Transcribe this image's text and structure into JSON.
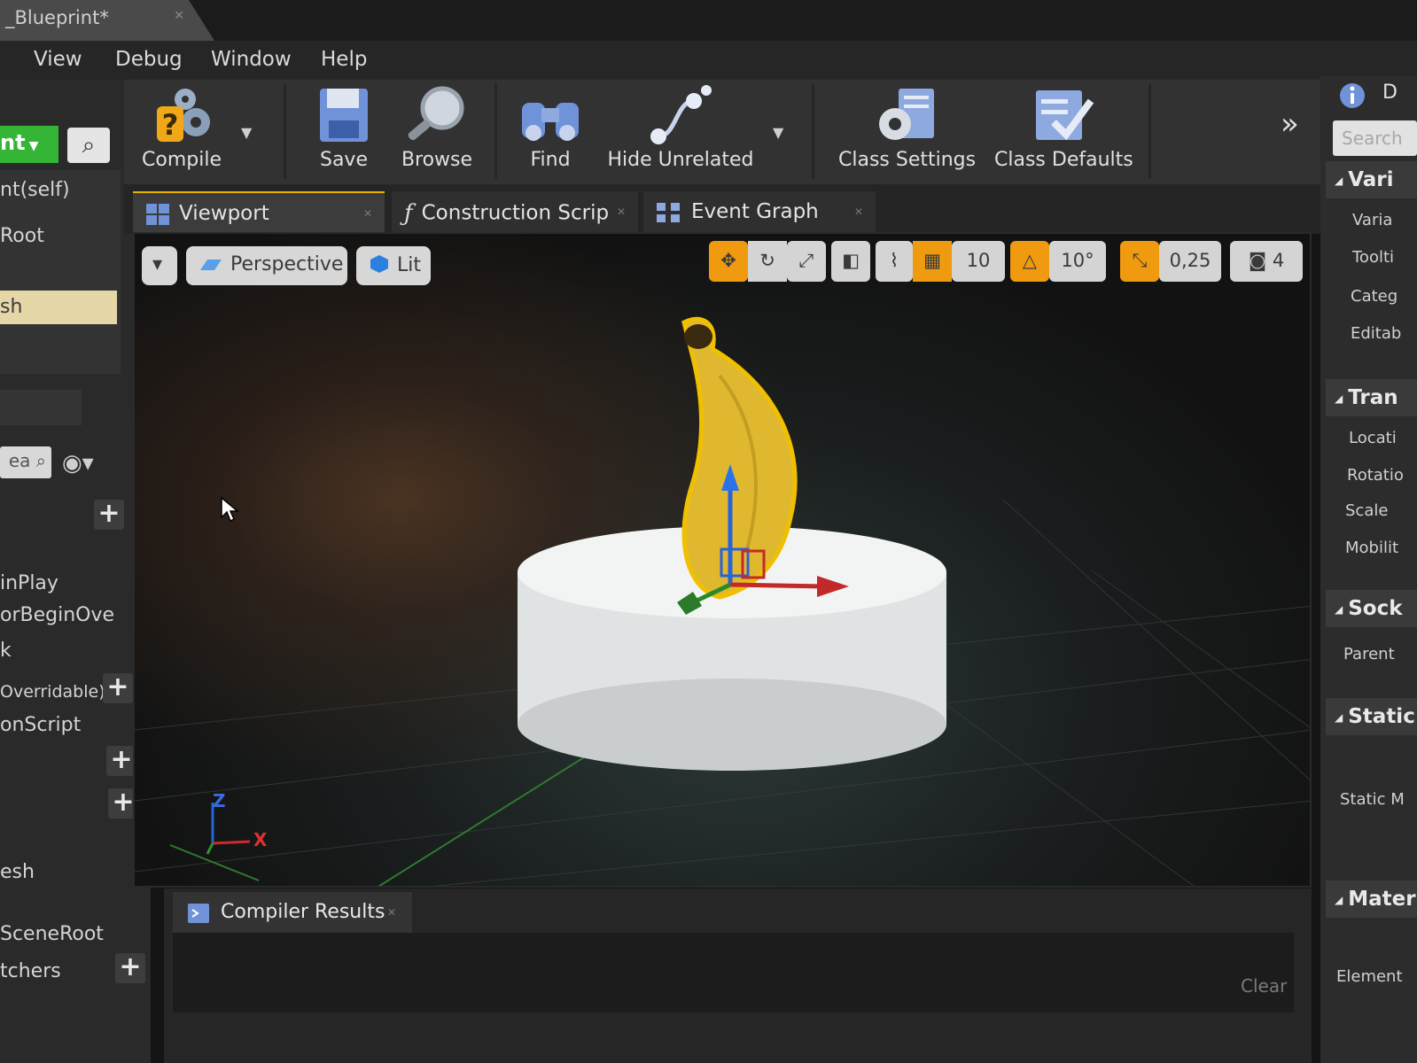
{
  "window": {
    "tab_title": "_Blueprint*"
  },
  "menu": {
    "items": [
      "View",
      "Debug",
      "Window",
      "Help"
    ]
  },
  "left_panel": {
    "add_button": "nt",
    "rows_top": [
      "nt(self)",
      "Root",
      "sh"
    ],
    "search_placeholder": "ea",
    "rows_bottom": [
      "inPlay",
      "orBeginOve",
      "k",
      "Overridable)",
      "onScript",
      "esh",
      "SceneRoot",
      "tchers"
    ]
  },
  "toolbar": {
    "compile": "Compile",
    "save": "Save",
    "browse": "Browse",
    "find": "Find",
    "hide_unrelated": "Hide Unrelated",
    "class_settings": "Class Settings",
    "class_defaults": "Class Defaults"
  },
  "editor_tabs": [
    "Viewport",
    "Construction Scrip",
    "Event Graph"
  ],
  "viewport": {
    "view_mode": "Perspective",
    "lighting": "Lit",
    "grid_snap": "10",
    "rotation_snap": "10°",
    "scale_snap": "0,25",
    "camera_speed": "4",
    "axis_x": "X",
    "axis_z": "Z"
  },
  "compiler": {
    "tab": "Compiler Results",
    "clear": "Clear"
  },
  "details": {
    "header_letter": "D",
    "search_placeholder": "Search",
    "sections": [
      {
        "title": "Vari",
        "props": [
          "Varia",
          "Toolti",
          "Categ",
          "Editab"
        ]
      },
      {
        "title": "Tran",
        "props": [
          "Locati",
          "Rotatio",
          "Scale",
          "Mobilit"
        ]
      },
      {
        "title": "Sock",
        "props": [
          "Parent"
        ]
      },
      {
        "title": "Static",
        "props": [
          "Static M"
        ]
      },
      {
        "title": "Mater",
        "props": [
          "Element"
        ]
      }
    ]
  },
  "colors": {
    "accent_orange": "#f09a10",
    "add_green": "#35b535",
    "selection": "#e6d7a8",
    "tab_highlight": "#e8b400"
  }
}
